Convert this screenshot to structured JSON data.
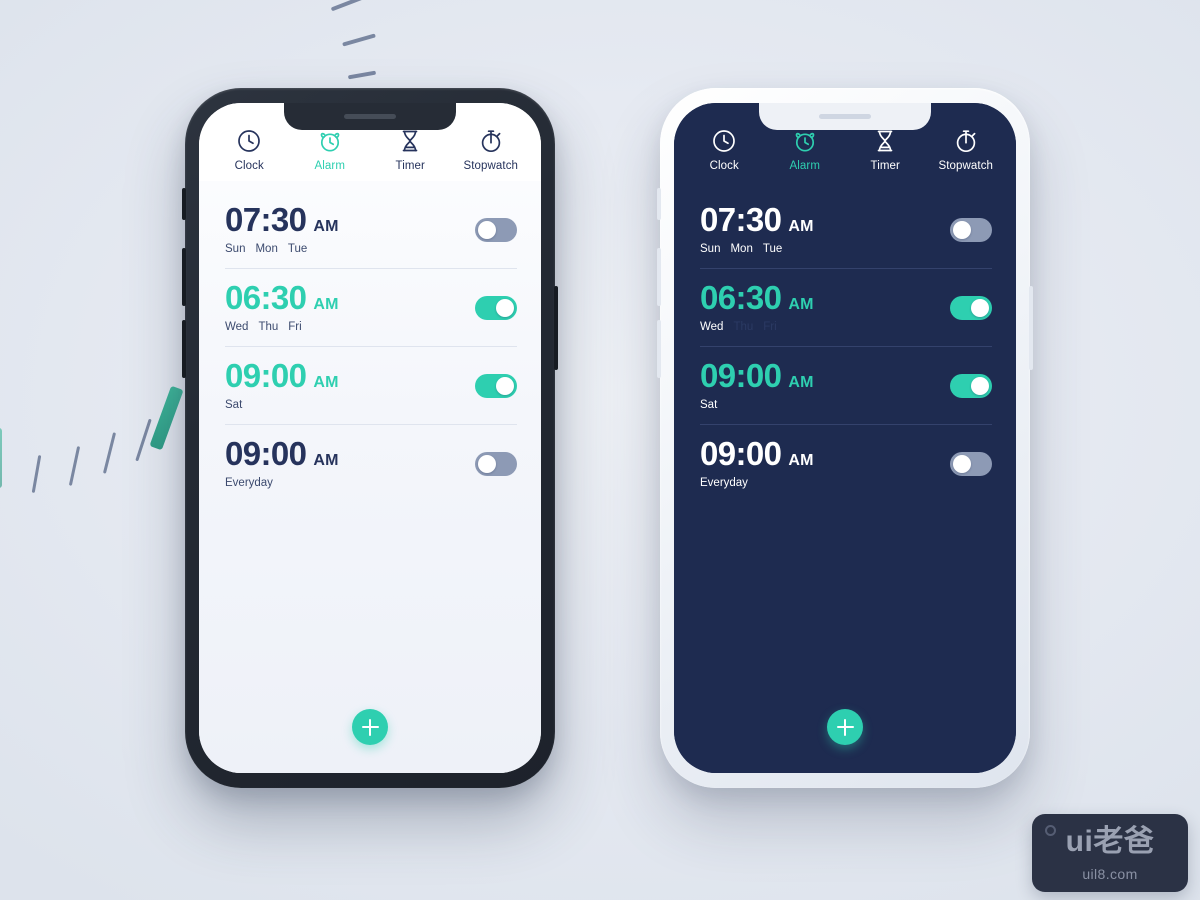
{
  "background_color": "#e4e9f1",
  "accent_color": "#2ecfb0",
  "navy_color": "#1e2b50",
  "toggle_off_color": "#8d9ab5",
  "tabs": [
    {
      "label": "Clock",
      "icon": "clock-icon",
      "active": false
    },
    {
      "label": "Alarm",
      "icon": "alarm-clock-icon",
      "active": true
    },
    {
      "label": "Timer",
      "icon": "hourglass-icon",
      "active": false
    },
    {
      "label": "Stopwatch",
      "icon": "stopwatch-icon",
      "active": false
    }
  ],
  "phone_light": {
    "theme": "light",
    "alarms": [
      {
        "time": "07:30",
        "meridiem": "AM",
        "days": [
          "Sun",
          "Mon",
          "Tue"
        ],
        "enabled": false
      },
      {
        "time": "06:30",
        "meridiem": "AM",
        "days": [
          "Wed",
          "Thu",
          "Fri"
        ],
        "enabled": true
      },
      {
        "time": "09:00",
        "meridiem": "AM",
        "days": [
          "Sat"
        ],
        "enabled": true
      },
      {
        "time": "09:00",
        "meridiem": "AM",
        "days": [
          "Everyday"
        ],
        "enabled": false
      }
    ],
    "fab_label": "add-alarm"
  },
  "phone_dark": {
    "theme": "dark",
    "alarms": [
      {
        "time": "07:30",
        "meridiem": "AM",
        "days": [
          "Sun",
          "Mon",
          "Tue"
        ],
        "enabled": false
      },
      {
        "time": "06:30",
        "meridiem": "AM",
        "days": [
          "Wed",
          "Thu",
          "Fri"
        ],
        "enabled": true,
        "muted_from": 1
      },
      {
        "time": "09:00",
        "meridiem": "AM",
        "days": [
          "Sat"
        ],
        "enabled": true
      },
      {
        "time": "09:00",
        "meridiem": "AM",
        "days": [
          "Everyday"
        ],
        "enabled": false
      }
    ],
    "fab_label": "add-alarm"
  },
  "watermark": {
    "main": "ui老爸",
    "sub": "uil8.com"
  }
}
